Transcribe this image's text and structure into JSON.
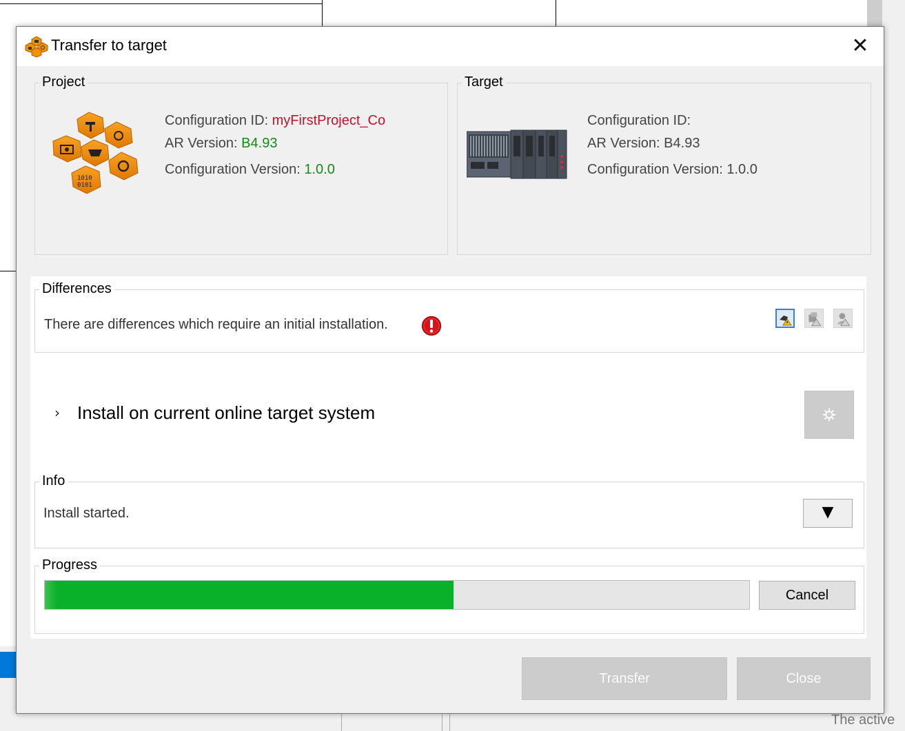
{
  "dialog": {
    "title": "Transfer to target",
    "close_glyph": "✕"
  },
  "project": {
    "group_label": "Project",
    "config_id_label": "Configuration ID:",
    "config_id_value": "myFirstProject_Co",
    "ar_version_label": "AR Version:",
    "ar_version_value": "B4.93",
    "config_version_label": "Configuration Version:",
    "config_version_value": "1.0.0",
    "icon": "automation-studio-logo-icon"
  },
  "target": {
    "group_label": "Target",
    "config_id_label": "Configuration ID:",
    "ar_version_label": "AR Version:",
    "ar_version_value": "B4.93",
    "config_version_label": "Configuration Version:",
    "config_version_value": "1.0.0",
    "icon": "plc-hardware-icon"
  },
  "differences": {
    "group_label": "Differences",
    "message": "There are differences which require an initial installation.",
    "status_icon": "error-icon",
    "tool_buttons": [
      "hardware-warning-icon",
      "software-warning-icon",
      "user-warning-icon"
    ]
  },
  "install": {
    "chevron": "›",
    "label": "Install on current online target system",
    "settings_icon": "gear-icon"
  },
  "info": {
    "group_label": "Info",
    "message": "Install started.",
    "expand_glyph": "▼"
  },
  "progress": {
    "group_label": "Progress",
    "percent": 58,
    "cancel_label": "Cancel"
  },
  "footer": {
    "transfer_label": "Transfer",
    "close_label": "Close"
  },
  "background": {
    "status_text": "The active"
  },
  "colors": {
    "error_red": "#c8102e",
    "ok_green": "#168a16",
    "progress_green": "#09b02a",
    "accent_blue": "#0078d7"
  }
}
